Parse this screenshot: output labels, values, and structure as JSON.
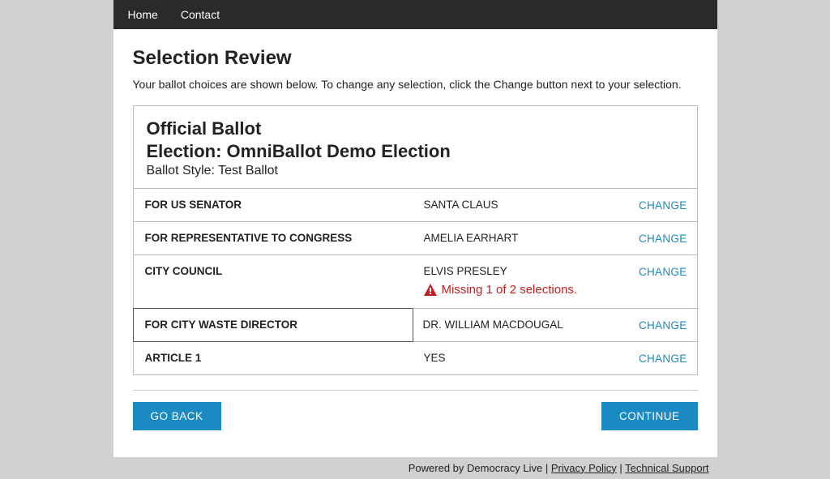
{
  "nav": {
    "home": "Home",
    "contact": "Contact"
  },
  "page": {
    "title": "Selection Review",
    "subtitle": "Your ballot choices are shown below. To change any selection, click the Change button next to your selection."
  },
  "ballot": {
    "header_line1": "Official Ballot",
    "header_line2": "Election: OmniBallot Demo Election",
    "style": "Ballot Style: Test Ballot",
    "change_label": "CHANGE",
    "rows": [
      {
        "contest": "FOR US SENATOR",
        "selection": "SANTA CLAUS",
        "warning": ""
      },
      {
        "contest": "FOR REPRESENTATIVE TO CONGRESS",
        "selection": "AMELIA EARHART",
        "warning": ""
      },
      {
        "contest": "CITY COUNCIL",
        "selection": "ELVIS PRESLEY",
        "warning": "Missing 1 of 2 selections."
      },
      {
        "contest": "FOR CITY WASTE DIRECTOR",
        "selection": "DR. WILLIAM MACDOUGAL",
        "warning": ""
      },
      {
        "contest": "ARTICLE 1",
        "selection": "YES",
        "warning": ""
      }
    ]
  },
  "buttons": {
    "back": "GO BACK",
    "continue": "CONTINUE"
  },
  "footer": {
    "powered": "Powered by Democracy Live",
    "privacy": "Privacy Policy",
    "support": "Technical Support"
  }
}
